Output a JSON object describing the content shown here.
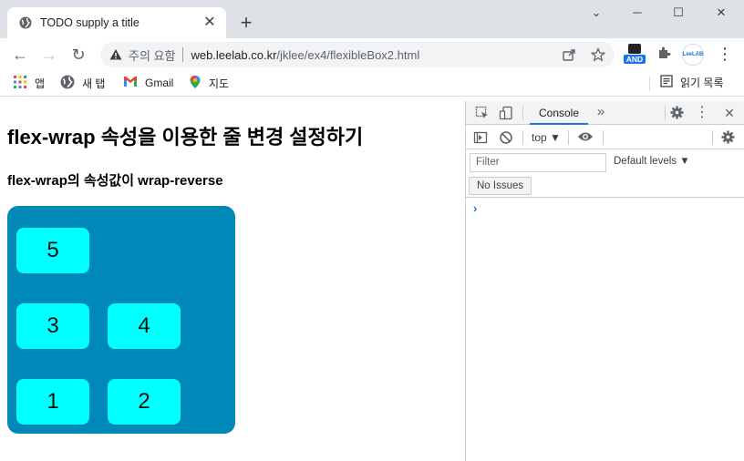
{
  "tab": {
    "title": "TODO supply a title",
    "close": "✕",
    "new_tab": "+"
  },
  "window": {
    "minimize": "⌄",
    "maximize": "☐",
    "restore": "─",
    "close": "✕"
  },
  "nav": {
    "back": "←",
    "forward": "→",
    "reload": "↻"
  },
  "omnibox": {
    "security_warning": "주의 요함",
    "host": "web.leelab.co.kr",
    "path": "/jklee/ex4/flexibleBox2.html"
  },
  "extensions": {
    "and_badge": "AND",
    "leelab": "LeeLAB",
    "menu": "⋮"
  },
  "bookmarks": [
    {
      "label": "앱"
    },
    {
      "label": "새 탭"
    },
    {
      "label": "Gmail"
    },
    {
      "label": "지도"
    }
  ],
  "reading_list": "읽기 목록",
  "page": {
    "heading": "flex-wrap 속성을 이용한 줄 변경 설정하기",
    "subheading": "flex-wrap의 속성값이 wrap-reverse",
    "items": [
      "1",
      "2",
      "3",
      "4",
      "5"
    ]
  },
  "devtools": {
    "tab_console": "Console",
    "more_tabs": "»",
    "context": "top ▼",
    "filter_placeholder": "Filter",
    "levels": "Default levels ▼",
    "issues": "No Issues",
    "prompt": "›"
  },
  "colors": {
    "flex_container": "#0088b8",
    "flex_item": "#00ffff",
    "tabstrip": "#dee1e6",
    "accent": "#1a73e8"
  }
}
